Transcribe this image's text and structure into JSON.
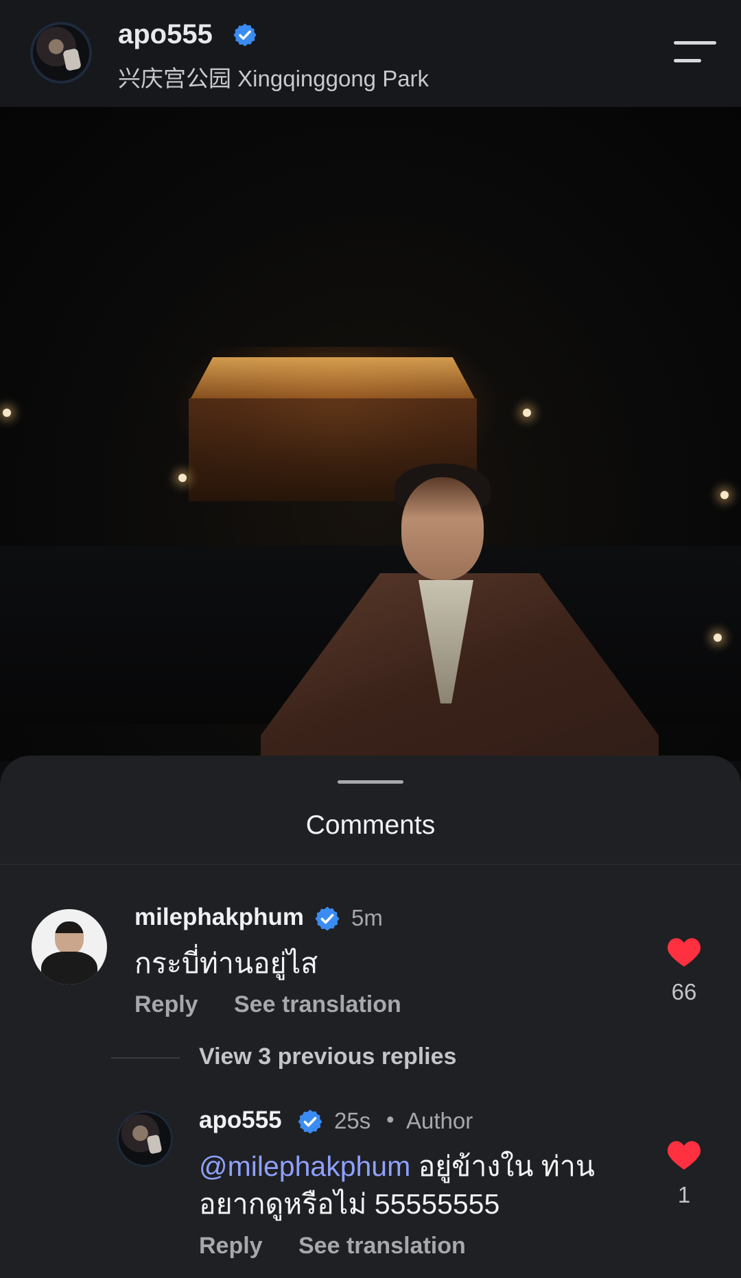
{
  "header": {
    "username": "apo555",
    "location": "兴庆宫公园 Xingqinggong Park",
    "icons": {
      "verified": "verified-badge-icon",
      "menu": "hamburger-menu-icon"
    }
  },
  "photo": {
    "alt": ""
  },
  "comments_sheet": {
    "title": "Comments",
    "comment": {
      "username": "milephakphum",
      "time": "5m",
      "text": "กระบี่ท่านอยู่ไส",
      "reply_label": "Reply",
      "translate_label": "See translation",
      "likes": "66"
    },
    "view_replies": "View 3 previous replies",
    "reply": {
      "username": "apo555",
      "time": "25s",
      "separator": "•",
      "badge": "Author",
      "mention": "@milephakphum",
      "text_line1": " อยู่ข้างใน ท่าน",
      "text_line2": "อยากดูหรือไม่ 55555555",
      "reply_label": "Reply",
      "translate_label": "See translation",
      "likes": "1"
    }
  },
  "colors": {
    "like": "#ff3040",
    "verified": "#3b8cf2",
    "mention": "#8ea1ff"
  }
}
